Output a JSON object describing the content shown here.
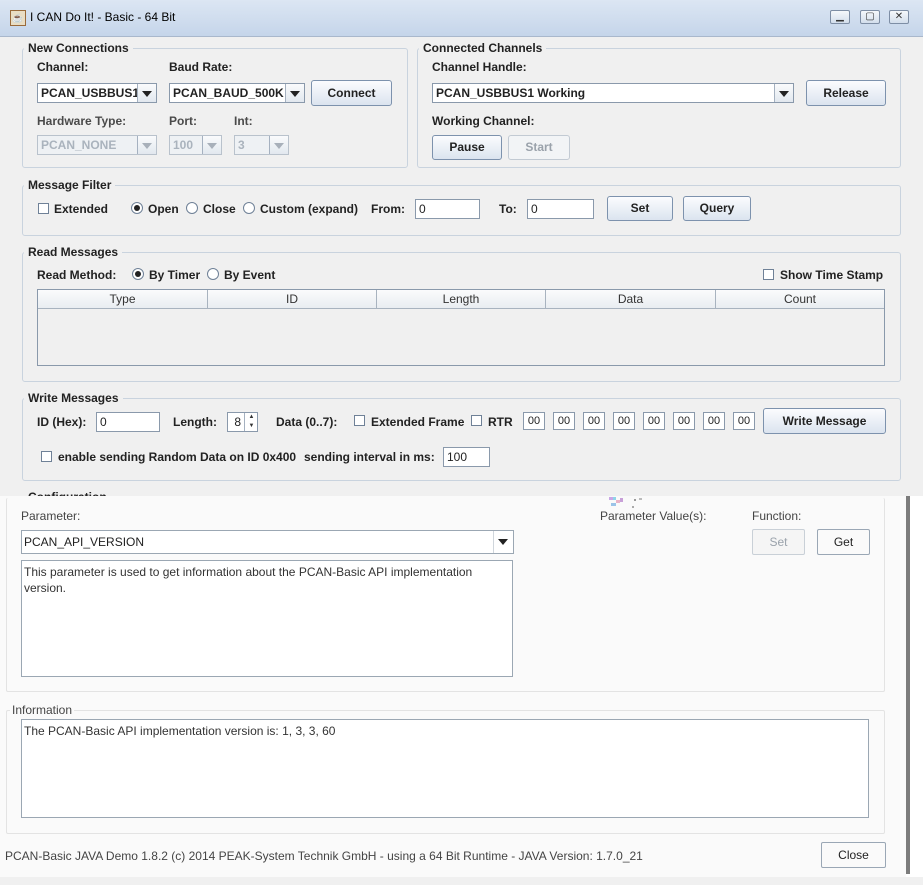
{
  "window": {
    "title": "I CAN Do It! - Basic - 64 Bit"
  },
  "new_connections": {
    "legend": "New Connections",
    "channel_label": "Channel:",
    "channel_value": "PCAN_USBBUS1",
    "baud_label": "Baud Rate:",
    "baud_value": "PCAN_BAUD_500K",
    "connect_button": "Connect",
    "hardware_label": "Hardware Type:",
    "hardware_value": "PCAN_NONE",
    "port_label": "Port:",
    "port_value": "100",
    "int_label": "Int:",
    "int_value": "3"
  },
  "connected_channels": {
    "legend": "Connected Channels",
    "handle_label": "Channel Handle:",
    "handle_value": "PCAN_USBBUS1 Working",
    "release_button": "Release",
    "working_label": "Working Channel:",
    "pause_button": "Pause",
    "start_button": "Start"
  },
  "message_filter": {
    "legend": "Message Filter",
    "extended_label": "Extended",
    "open_label": "Open",
    "close_label": "Close",
    "custom_label": "Custom (expand)",
    "from_label": "From:",
    "from_value": "0",
    "to_label": "To:",
    "to_value": "0",
    "set_button": "Set",
    "query_button": "Query"
  },
  "read_messages": {
    "legend": "Read Messages",
    "method_label": "Read Method:",
    "by_timer_label": "By Timer",
    "by_event_label": "By Event",
    "timestamp_label": "Show Time Stamp",
    "columns": [
      "Type",
      "ID",
      "Length",
      "Data",
      "Count"
    ]
  },
  "write_messages": {
    "legend": "Write Messages",
    "id_label": "ID (Hex):",
    "id_value": "0",
    "length_label": "Length:",
    "length_value": "8",
    "data_label": "Data (0..7):",
    "extended_frame_label": "Extended Frame",
    "rtr_label": "RTR",
    "data_bytes": [
      "00",
      "00",
      "00",
      "00",
      "00",
      "00",
      "00",
      "00"
    ],
    "write_button": "Write Message",
    "random_label": "enable sending Random Data on ID 0x400",
    "interval_label": "sending interval in ms:",
    "interval_value": "100"
  },
  "configuration": {
    "legend": "Configuration",
    "parameter_label": "Parameter:",
    "parameter_value": "PCAN_API_VERSION",
    "description": "This parameter is used to get information about the PCAN-Basic API implementation version.",
    "values_label": "Parameter Value(s):",
    "function_label": "Function:",
    "set_button": "Set",
    "get_button": "Get"
  },
  "information": {
    "legend": "Information",
    "text": "The PCAN-Basic API implementation version is: 1, 3, 3, 60"
  },
  "status": {
    "text": "PCAN-Basic JAVA Demo 1.8.2  (c) 2014 PEAK-System Technik GmbH - using a 64 Bit Runtime - JAVA Version: 1.7.0_21",
    "close_button": "Close"
  }
}
